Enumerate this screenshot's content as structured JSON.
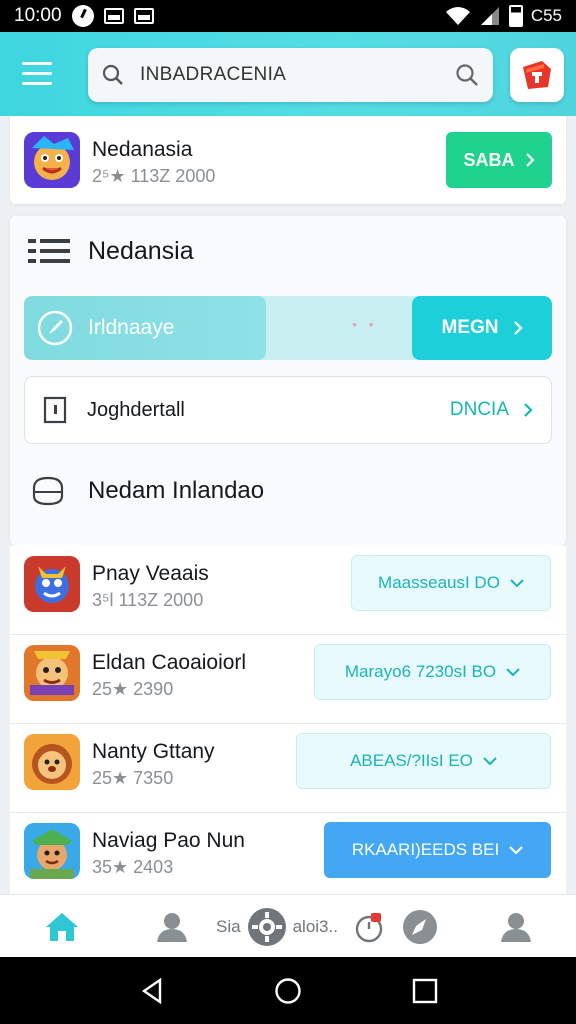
{
  "status_bar": {
    "time": "10:00",
    "battery_text": "C55"
  },
  "search": {
    "value": "INBADRACENIA"
  },
  "featured": {
    "name": "Nedanasia",
    "meta": "2⁵★ 113Z 2000",
    "button": "SABA"
  },
  "section": {
    "title": "Nedansia",
    "promo_label": "Irldnaaye",
    "promo_dots": "• •",
    "promo_button": "MEGN",
    "detail_label": "Joghdertall",
    "detail_link": "DNCIA",
    "subheading": "Nedam Inlandao"
  },
  "apps": [
    {
      "name": "Pnay Veaais",
      "meta": "3⁵l 113Z 2000",
      "button": "MaasseausI DO",
      "style": "light"
    },
    {
      "name": "Eldan Caoaioiorl",
      "meta": "25★ 2390",
      "button": "Marayo6 7230sI BO",
      "style": "light"
    },
    {
      "name": "Nanty Gttany",
      "meta": "25★ 7350",
      "button": "ABEAS/?IIsI EO",
      "style": "light"
    },
    {
      "name": "Naviag Pao Nun",
      "meta": "35★ 2403",
      "button": "RKAARI)EEDS BEI",
      "style": "blue"
    }
  ],
  "bottom_nav": {
    "label_left": "Sia",
    "label_right": "aloi3.."
  },
  "colors": {
    "accent": "#3fd6df",
    "green": "#1fd28e",
    "blue": "#43a7f4",
    "teal": "#1dcfd8"
  },
  "icons": [
    "menu-icon",
    "search-icon",
    "store-icon",
    "list-icon",
    "compass-icon",
    "door-icon",
    "chat-icon",
    "chevron-right-icon",
    "chevron-down-icon",
    "home-icon",
    "person-icon",
    "gear-icon",
    "timer-icon",
    "rocket-icon",
    "back-icon",
    "circle-home-icon",
    "square-recents-icon"
  ]
}
